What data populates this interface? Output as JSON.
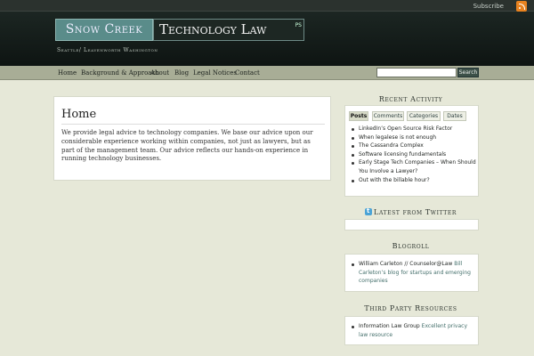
{
  "header": {
    "subscribe_label": "Subscribe",
    "logo_left": "Snow Creek",
    "logo_right": "Technology Law",
    "logo_sup": "PS",
    "tagline": "Seattle/ Leavenworth  Washington"
  },
  "nav": {
    "items": [
      "Home",
      "Background & Approach",
      "About",
      "Blog",
      "Legal Notices",
      "Contact"
    ],
    "search_placeholder": "",
    "search_label": "Search"
  },
  "main": {
    "title": "Home",
    "body": "We provide legal advice to technology companies. We base our advice upon our considerable experience working within companies, not just as lawyers, but as part of the management team. Our advice reflects our  hands-on experience in running technology businesses."
  },
  "sidebar": {
    "recent_title": "Recent Activity",
    "tabs": [
      "Posts",
      "Comments",
      "Categories",
      "Dates"
    ],
    "posts": [
      "LinkedIn’s Open Source Risk Factor",
      "When legalese is not enough",
      "The Cassandra Complex",
      "Software licensing fundamentals",
      "Early Stage Tech Companies – When Should You Involve a Lawyer?",
      "Out with the billable hour?"
    ],
    "twitter_title": "Latest from Twitter",
    "blogroll_title": "Blogroll",
    "blogroll": [
      {
        "name": "William Carleton // Counselor@Law",
        "desc": "Bill Carleton’s blog for startups and emerging companies"
      }
    ],
    "third_party_title": "Third Party Resources",
    "resources": [
      {
        "name": "Information Law Group",
        "desc": "Excellent privacy law resource"
      }
    ]
  }
}
